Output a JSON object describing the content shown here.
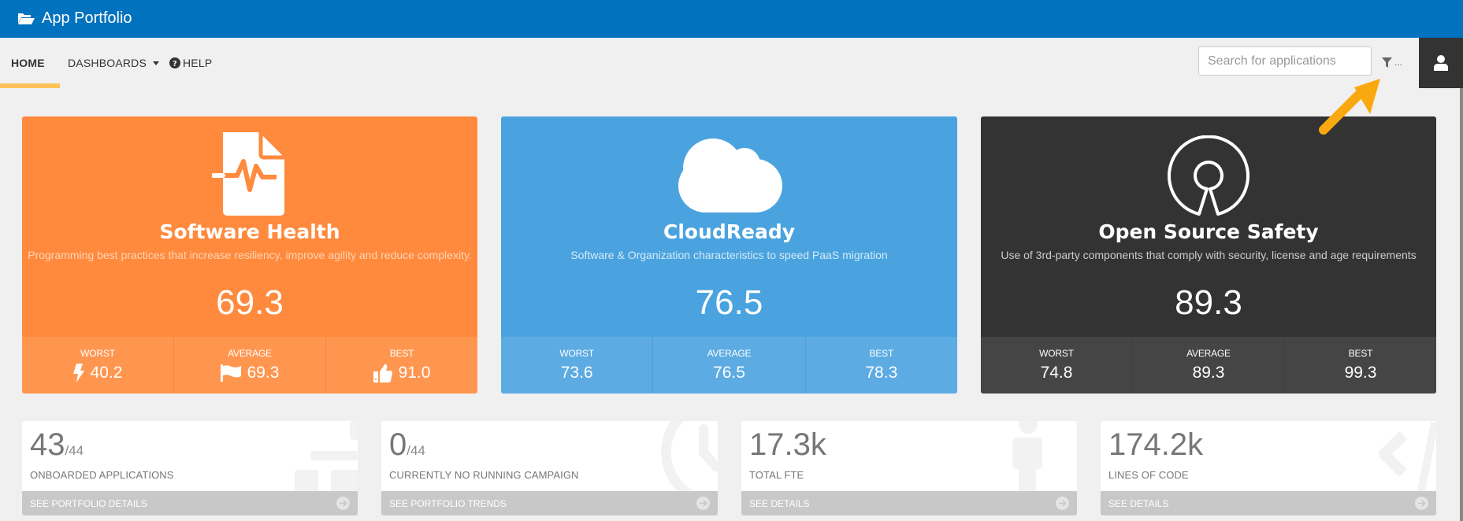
{
  "app": {
    "title": "App Portfolio",
    "brand_icon": "folder-open-icon"
  },
  "nav": {
    "items": [
      {
        "label": "HOME",
        "active": true
      },
      {
        "label": "DASHBOARDS",
        "icon": "caret-down-icon"
      },
      {
        "label": "HELP",
        "icon": "question-circle-icon"
      }
    ],
    "active_color": "#fec25a"
  },
  "search": {
    "placeholder": "Search for applications",
    "value": ""
  },
  "filter": {
    "icon": "filter-icon",
    "label": "..."
  },
  "user": {
    "icon": "user-icon"
  },
  "cards": [
    {
      "title": "Software Health",
      "description": "Programming best practices that increase resiliency, improve agility and reduce complexity.",
      "score": "69.3",
      "icon": "file-pulse-icon",
      "color": "#ff8a3d",
      "stats": [
        {
          "label": "WORST",
          "value": "40.2",
          "icon": "bolt-icon"
        },
        {
          "label": "AVERAGE",
          "value": "69.3",
          "icon": "flag-icon"
        },
        {
          "label": "BEST",
          "value": "91.0",
          "icon": "thumbs-up-icon"
        }
      ]
    },
    {
      "title": "CloudReady",
      "description": "Software & Organization characteristics to speed PaaS migration",
      "score": "76.5",
      "icon": "cloud-icon",
      "color": "#4aa3df",
      "stats": [
        {
          "label": "WORST",
          "value": "73.6"
        },
        {
          "label": "AVERAGE",
          "value": "76.5"
        },
        {
          "label": "BEST",
          "value": "78.3"
        }
      ]
    },
    {
      "title": "Open Source Safety",
      "description": "Use of 3rd-party components that comply with security, license and age requirements",
      "score": "89.3",
      "icon": "open-source-icon",
      "color": "#333333",
      "stats": [
        {
          "label": "WORST",
          "value": "74.8"
        },
        {
          "label": "AVERAGE",
          "value": "89.3"
        },
        {
          "label": "BEST",
          "value": "99.3"
        }
      ]
    }
  ],
  "tiles": [
    {
      "value": "43",
      "suffix": "/44",
      "label": "ONBOARDED APPLICATIONS",
      "link": "SEE PORTFOLIO DETAILS",
      "icon": "sitemap-icon"
    },
    {
      "value": "0",
      "suffix": "/44",
      "label": "CURRENTLY NO RUNNING CAMPAIGN",
      "link": "SEE PORTFOLIO TRENDS",
      "icon": "clock-icon"
    },
    {
      "value": "17.3k",
      "suffix": "",
      "label": "TOTAL FTE",
      "link": "SEE DETAILS",
      "icon": "person-icon"
    },
    {
      "value": "174.2k",
      "suffix": "",
      "label": "LINES OF CODE",
      "link": "SEE DETAILS",
      "icon": "code-icon"
    }
  ],
  "annotation": {
    "icon": "pointer-arrow-icon",
    "color": "#f9a90f"
  }
}
